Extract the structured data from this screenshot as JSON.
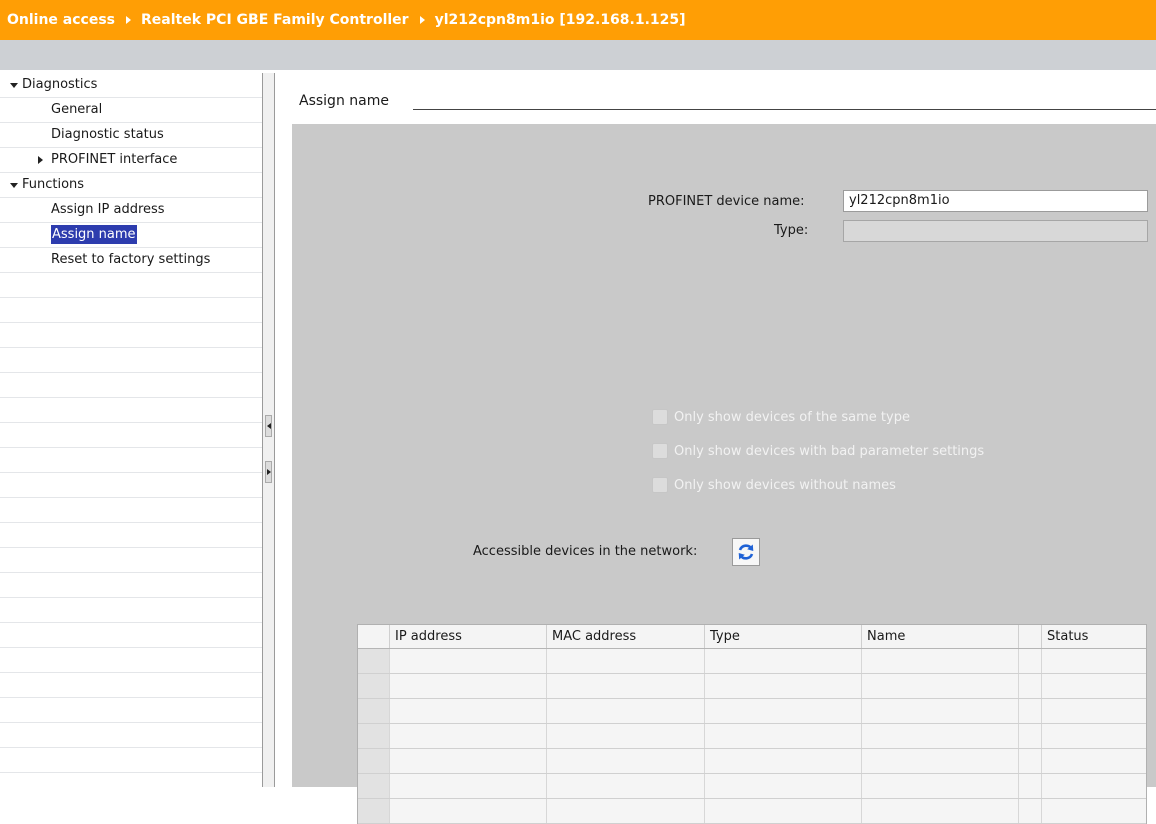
{
  "breadcrumb": [
    "Online access",
    "Realtek PCI GBE Family Controller",
    "yl212cpn8m1io [192.168.1.125]"
  ],
  "nav": [
    {
      "label": "Diagnostics",
      "level": 0,
      "caret": "down"
    },
    {
      "label": "General",
      "level": 1
    },
    {
      "label": "Diagnostic status",
      "level": 1
    },
    {
      "label": "PROFINET interface",
      "level": 1,
      "caret": "right"
    },
    {
      "label": "Functions",
      "level": 0,
      "caret": "down"
    },
    {
      "label": "Assign IP address",
      "level": 1
    },
    {
      "label": "Assign name",
      "level": 1,
      "selected": true
    },
    {
      "label": "Reset to factory settings",
      "level": 1
    }
  ],
  "content": {
    "section_title": "Assign name",
    "device_name_label": "PROFINET device name:",
    "device_name_value": "yl212cpn8m1io",
    "type_label": "Type:",
    "type_value": "",
    "filters": [
      "Only show devices of the same type",
      "Only show devices with bad parameter settings",
      "Only show devices without names"
    ],
    "accessible_label": "Accessible devices in the network:",
    "table": {
      "columns": [
        "",
        "IP address",
        "MAC address",
        "Type",
        "Name",
        "",
        "Status"
      ],
      "rows": [
        [],
        [],
        [],
        [],
        [],
        [],
        []
      ]
    }
  },
  "colors": {
    "titlebar": "#ff9e05",
    "selection": "#2d3cae",
    "panel": "#c9c9c9",
    "refresh_icon": "#1f62d6"
  },
  "icons": {
    "refresh": "refresh-icon",
    "collapse": "caret-down-icon",
    "expand": "caret-right-icon"
  }
}
